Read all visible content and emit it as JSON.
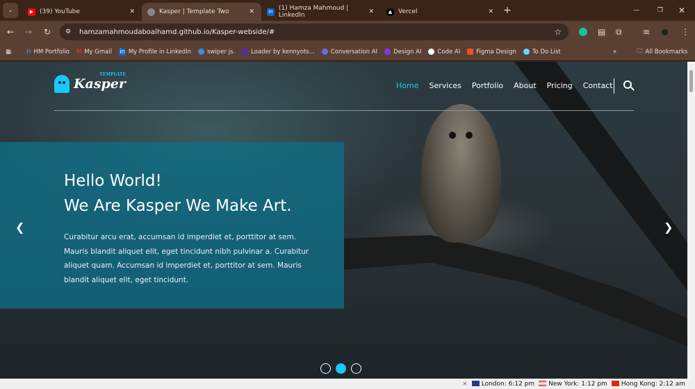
{
  "browser": {
    "tabs": [
      {
        "title": "(39) YouTube",
        "color": "#ff0000"
      },
      {
        "title": "Kasper | Template Two",
        "color": "#888888"
      },
      {
        "title": "(1) Hamza Mahmoud | LinkedIn",
        "color": "#0a66c2"
      },
      {
        "title": "Vercel",
        "color": "#000000"
      }
    ],
    "url": "hamzamahmoudaboalhamd.github.io/Kasper-webside/#",
    "bookmarks": [
      "HM Portfolio",
      "My Gmail",
      "My Profile in LinkedIn",
      "swiper js.",
      "Loader by kennyots...",
      "Conversation AI",
      "Design AI",
      "Code AI",
      "Figma Design",
      "To Do List"
    ],
    "all_bookmarks": "All Bookmarks"
  },
  "site": {
    "logo": "Kasper",
    "logo_sub": "TEMPLATE",
    "accent": "#19c8fa",
    "nav": [
      "Home",
      "Services",
      "Portfolio",
      "About",
      "Pricing",
      "Contact"
    ],
    "hero": {
      "line1": "Hello World!",
      "line2": "We Are Kasper We Make Art.",
      "text": "Curabitur arcu erat, accumsan id imperdiet et, porttitor at sem. Mauris blandit aliquet elit, eget tincidunt nibh pulvinar a. Curabitur aliquet quam. Accumsan id imperdiet et, porttitor at sem. Mauris blandit aliquet elit, eget tincidunt."
    },
    "active_slide": 2,
    "slide_count": 3
  },
  "clocks": [
    "London: 6:12 pm",
    "New York: 1:12 pm",
    "Hong Kong: 2:12 am"
  ]
}
